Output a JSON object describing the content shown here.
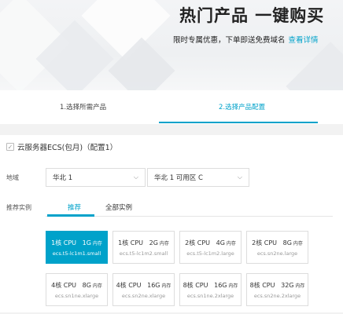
{
  "hero": {
    "title": "热门产品 一键购买",
    "subtitle": "限时专属优惠，下单即送免费域名",
    "link": "查看详情"
  },
  "steps": [
    {
      "label": "1.选择所需产品"
    },
    {
      "label": "2.选择产品配置"
    }
  ],
  "product": {
    "title": "云服务器ECS(包月)（配置1）"
  },
  "region": {
    "label": "地域",
    "region_value": "华北 1",
    "zone_value": "华北 1 可用区 C"
  },
  "instance": {
    "label": "推荐实例",
    "tabs": [
      "推荐",
      "全部实例"
    ],
    "cards": [
      {
        "cpu": "1核 CPU",
        "mem": "1G",
        "mem_unit": "内存",
        "type": "ecs.t5-lc1m1.small",
        "selected": true
      },
      {
        "cpu": "1核 CPU",
        "mem": "2G",
        "mem_unit": "内存",
        "type": "ecs.t5-lc1m2.small",
        "selected": false
      },
      {
        "cpu": "2核 CPU",
        "mem": "4G",
        "mem_unit": "内存",
        "type": "ecs.t5-lc1m2.large",
        "selected": false
      },
      {
        "cpu": "2核 CPU",
        "mem": "8G",
        "mem_unit": "内存",
        "type": "ecs.sn2ne.large",
        "selected": false
      },
      {
        "cpu": "4核 CPU",
        "mem": "8G",
        "mem_unit": "内存",
        "type": "ecs.sn1ne.xlarge",
        "selected": false
      },
      {
        "cpu": "4核 CPU",
        "mem": "16G",
        "mem_unit": "内存",
        "type": "ecs.sn2ne.xlarge",
        "selected": false
      },
      {
        "cpu": "8核 CPU",
        "mem": "16G",
        "mem_unit": "内存",
        "type": "ecs.sn1ne.2xlarge",
        "selected": false
      },
      {
        "cpu": "8核 CPU",
        "mem": "32G",
        "mem_unit": "内存",
        "type": "ecs.sn2ne.2xlarge",
        "selected": false
      }
    ]
  },
  "colors": {
    "accent": "#00a2ca"
  }
}
